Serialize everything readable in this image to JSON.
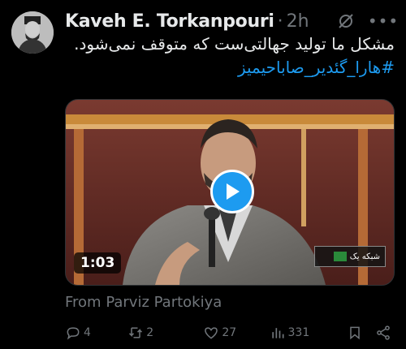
{
  "tweet": {
    "author_name": "Kaveh E. Torkanpouri",
    "time": "2h",
    "text": "مشکل ما تولید جهالتی‌ست که متوقف نمی‌شود.",
    "hashtag": "#هارا_گئدیر_صاباحیمیز"
  },
  "media": {
    "duration": "1:03",
    "channel_logo_text": "شبکه یک"
  },
  "attribution": "From Parviz Partokiya",
  "actions": {
    "replies": "4",
    "reposts": "2",
    "likes": "27",
    "views": "331"
  },
  "colors": {
    "accent": "#1d9bf0",
    "muted": "#71767b",
    "background": "#000000"
  }
}
